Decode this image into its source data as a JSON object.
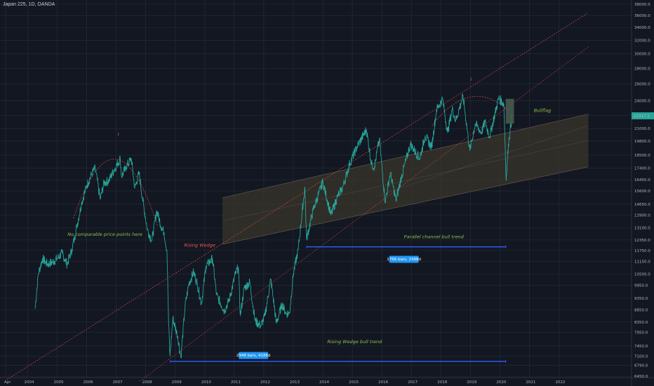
{
  "header": {
    "symbol": "Japan 225, 1D, OANDA"
  },
  "chart_data": {
    "type": "line",
    "title": "",
    "x": [
      "2004",
      "2005",
      "2006",
      "2007",
      "2008",
      "2009",
      "2010",
      "2011",
      "2012",
      "2013",
      "2014",
      "2015",
      "2016",
      "2017",
      "2018",
      "2019",
      "2020",
      "2021",
      "2022"
    ],
    "x_tick_labels": [
      "Apr",
      "2004",
      "2005",
      "2006",
      "2007",
      "2008",
      "2009",
      "2010",
      "2011",
      "2012",
      "2013",
      "2014",
      "2015",
      "2016",
      "2017",
      "2018",
      "2019",
      "2020",
      "2021",
      "2022"
    ],
    "y_tick_labels": [
      "6450.0",
      "6790.0",
      "7100.0",
      "7450.0",
      "7950.0",
      "8350.0",
      "8850.0",
      "9350.0",
      "9950.0",
      "10500.0",
      "11150.0",
      "11750.0",
      "12350.0",
      "13100.0",
      "13900.0",
      "14650.0",
      "15600.0",
      "16450.0",
      "17400.0",
      "18500.0",
      "19800.0",
      "21000.0",
      "22350.0",
      "24000.0",
      "26000.0",
      "28000.0",
      "30000.0",
      "32000.0",
      "34000.0",
      "36000.0",
      "38000.0"
    ],
    "y_scale": "log",
    "ylim": [
      6450,
      38000
    ],
    "last_price": "22317.2",
    "series": [
      {
        "values": [
          [
            "2004-04-01",
            8900
          ],
          [
            "2004-05-10",
            10500
          ],
          [
            "2004-07-01",
            11300
          ],
          [
            "2004-09-01",
            11000
          ],
          [
            "2004-11-01",
            11100
          ],
          [
            "2005-01-01",
            11300
          ],
          [
            "2005-03-01",
            11600
          ],
          [
            "2005-05-01",
            11000
          ],
          [
            "2005-07-01",
            11800
          ],
          [
            "2005-09-01",
            13200
          ],
          [
            "2005-11-01",
            14800
          ],
          [
            "2006-01-01",
            16000
          ],
          [
            "2006-03-01",
            16900
          ],
          [
            "2006-04-15",
            17400
          ],
          [
            "2006-06-15",
            15000
          ],
          [
            "2006-08-01",
            16200
          ],
          [
            "2006-10-01",
            16400
          ],
          [
            "2006-12-01",
            17200
          ],
          [
            "2007-02-20",
            18200
          ],
          [
            "2007-03-05",
            16700
          ],
          [
            "2007-05-01",
            17500
          ],
          [
            "2007-07-05",
            18200
          ],
          [
            "2007-08-17",
            15800
          ],
          [
            "2007-10-10",
            17000
          ],
          [
            "2007-11-20",
            15100
          ],
          [
            "2008-01-20",
            13000
          ],
          [
            "2008-03-15",
            12300
          ],
          [
            "2008-05-15",
            14200
          ],
          [
            "2008-07-15",
            13100
          ],
          [
            "2008-08-15",
            12800
          ],
          [
            "2008-09-20",
            11700
          ],
          [
            "2008-10-10",
            8300
          ],
          [
            "2008-10-27",
            7100
          ],
          [
            "2008-12-01",
            8500
          ],
          [
            "2009-02-01",
            7800
          ],
          [
            "2009-03-10",
            7050
          ],
          [
            "2009-05-01",
            9000
          ],
          [
            "2009-06-15",
            10000
          ],
          [
            "2009-08-15",
            10600
          ],
          [
            "2009-10-01",
            10000
          ],
          [
            "2009-11-20",
            9100
          ],
          [
            "2010-01-15",
            10900
          ],
          [
            "2010-04-05",
            11300
          ],
          [
            "2010-05-25",
            9500
          ],
          [
            "2010-08-31",
            8800
          ],
          [
            "2010-11-01",
            9300
          ],
          [
            "2011-01-15",
            10500
          ],
          [
            "2011-02-21",
            10850
          ],
          [
            "2011-03-15",
            8600
          ],
          [
            "2011-05-01",
            9800
          ],
          [
            "2011-07-10",
            10100
          ],
          [
            "2011-09-15",
            8400
          ],
          [
            "2011-11-25",
            8200
          ],
          [
            "2012-01-15",
            8600
          ],
          [
            "2012-03-27",
            10250
          ],
          [
            "2012-06-04",
            8300
          ],
          [
            "2012-08-15",
            9100
          ],
          [
            "2012-10-01",
            8700
          ],
          [
            "2012-11-15",
            8700
          ],
          [
            "2013-01-01",
            10500
          ],
          [
            "2013-03-01",
            11800
          ],
          [
            "2013-05-22",
            15900
          ],
          [
            "2013-06-13",
            12400
          ],
          [
            "2013-09-01",
            14200
          ],
          [
            "2013-12-31",
            16300
          ],
          [
            "2014-04-11",
            13900
          ],
          [
            "2014-07-01",
            15200
          ],
          [
            "2014-09-01",
            15800
          ],
          [
            "2014-12-01",
            17800
          ],
          [
            "2015-03-01",
            19300
          ],
          [
            "2015-06-24",
            20900
          ],
          [
            "2015-08-25",
            17700
          ],
          [
            "2015-10-01",
            17500
          ],
          [
            "2015-12-01",
            20000
          ],
          [
            "2016-02-12",
            14800
          ],
          [
            "2016-04-15",
            17000
          ],
          [
            "2016-06-24",
            14900
          ],
          [
            "2016-09-01",
            16700
          ],
          [
            "2016-12-20",
            19500
          ],
          [
            "2017-04-14",
            18200
          ],
          [
            "2017-06-20",
            20300
          ],
          [
            "2017-09-08",
            19200
          ],
          [
            "2017-11-09",
            23000
          ],
          [
            "2018-01-23",
            24200
          ],
          [
            "2018-03-23",
            20600
          ],
          [
            "2018-05-21",
            23100
          ],
          [
            "2018-07-01",
            21800
          ],
          [
            "2018-10-02",
            24500
          ],
          [
            "2018-12-25",
            18900
          ],
          [
            "2019-03-01",
            21500
          ],
          [
            "2019-05-15",
            20600
          ],
          [
            "2019-07-01",
            21700
          ],
          [
            "2019-08-26",
            20200
          ],
          [
            "2019-12-17",
            24300
          ],
          [
            "2020-02-20",
            23600
          ],
          [
            "2020-03-19",
            16400
          ],
          [
            "2020-04-15",
            19500
          ],
          [
            "2020-05-30",
            22300
          ]
        ]
      }
    ],
    "colors": {
      "background": "#131722",
      "grid": "#2a2e39",
      "price_line": "#26a69a",
      "trend_dotted": "#ef5350",
      "arc_dotted": "#ef5350",
      "channel_fill": "#3a352b",
      "channel_line": "#b4a082",
      "measure_line": "#2962ff",
      "label_box": "#2196f3",
      "annotation_green": "#8bc34a",
      "annotation_red": "#ef5350",
      "flag_box": "#4a5e4f",
      "price_tag": "#26a69a"
    },
    "annotations": [
      {
        "id": "no-price",
        "text": "No comparable price points here",
        "color": "green"
      },
      {
        "id": "rising-wedge",
        "text": "Rising Wedge",
        "color": "red"
      },
      {
        "id": "parallel-channel",
        "text": "Parallel channel bull trend",
        "color": "green"
      },
      {
        "id": "rising-wedge-bull",
        "text": "Rising Wedge bull trend",
        "color": "green"
      },
      {
        "id": "bullflag",
        "text": "Bullflag",
        "color": "green"
      }
    ],
    "measure_labels": [
      {
        "id": "measure-channel",
        "text": "1766 bars, 2498d"
      },
      {
        "id": "measure-wedge",
        "text": "2948 bars, 4186d"
      }
    ],
    "arc_markers": [
      {
        "id": "marker-2007",
        "text": "I"
      },
      {
        "id": "marker-2019",
        "text": "I"
      }
    ]
  }
}
